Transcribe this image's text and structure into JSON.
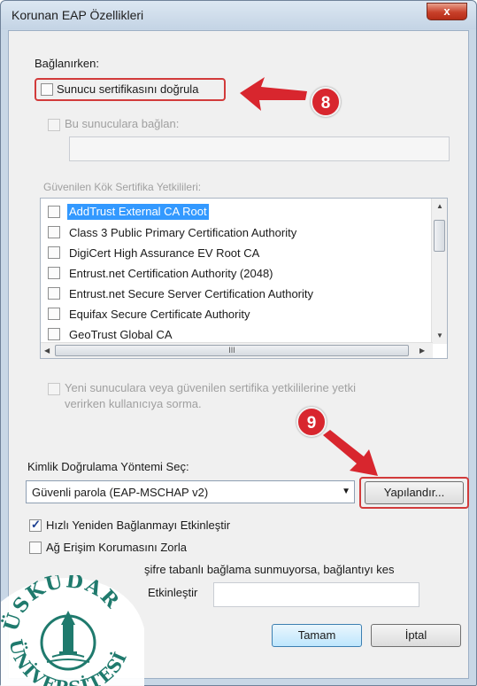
{
  "window": {
    "title": "Korunan EAP Özellikleri",
    "close_label": "x"
  },
  "connect_section": {
    "label": "Bağlanırken:",
    "verify_cert_label": "Sunucu sertifikasını doğrula",
    "verify_cert_checked": false,
    "connect_servers_label": "Bu sunuculara bağlan:",
    "servers_value": "",
    "trusted_ca_label": "Güvenilen Kök Sertifika Yetkilileri:",
    "ca_list": [
      {
        "label": "AddTrust External CA Root",
        "checked": false,
        "selected": true
      },
      {
        "label": "Class 3 Public Primary Certification Authority",
        "checked": false,
        "selected": false
      },
      {
        "label": "DigiCert High Assurance EV Root CA",
        "checked": false,
        "selected": false
      },
      {
        "label": "Entrust.net Certification Authority (2048)",
        "checked": false,
        "selected": false
      },
      {
        "label": "Entrust.net Secure Server Certification Authority",
        "checked": false,
        "selected": false
      },
      {
        "label": "Equifax Secure Certificate Authority",
        "checked": false,
        "selected": false
      },
      {
        "label": "GeoTrust Global CA",
        "checked": false,
        "selected": false
      }
    ],
    "scroll_grip": "III",
    "no_prompt_label_line1": "Yeni sunuculara veya güvenilen sertifika yetkililerine yetki",
    "no_prompt_label_line2": "verirken kullanıcıya sorma."
  },
  "auth_section": {
    "label": "Kimlik Doğrulama Yöntemi Seç:",
    "method_value": "Güvenli parola (EAP-MSCHAP v2)",
    "configure_label": "Yapılandır...",
    "fast_reconnect_label": "Hızlı Yeniden Bağlanmayı Etkinleştir",
    "fast_reconnect_checked": true,
    "nap_label": "Ağ Erişim Korumasını Zorla",
    "nap_checked": false,
    "disconnect_label": "şifre tabanlı bağlama sunmuyorsa, bağlantıyı kes",
    "identity_privacy_label": "Etkinleştir",
    "identity_value": ""
  },
  "buttons": {
    "ok_label": "Tamam",
    "cancel_label": "İptal"
  },
  "annotations": {
    "step_8": "8",
    "step_9": "9",
    "color": "#d8262e"
  },
  "watermark": {
    "top_text": "ÜSKÜDAR",
    "bottom_text": "ÜNİVERSİTESİ",
    "color": "#1f7a6d"
  }
}
